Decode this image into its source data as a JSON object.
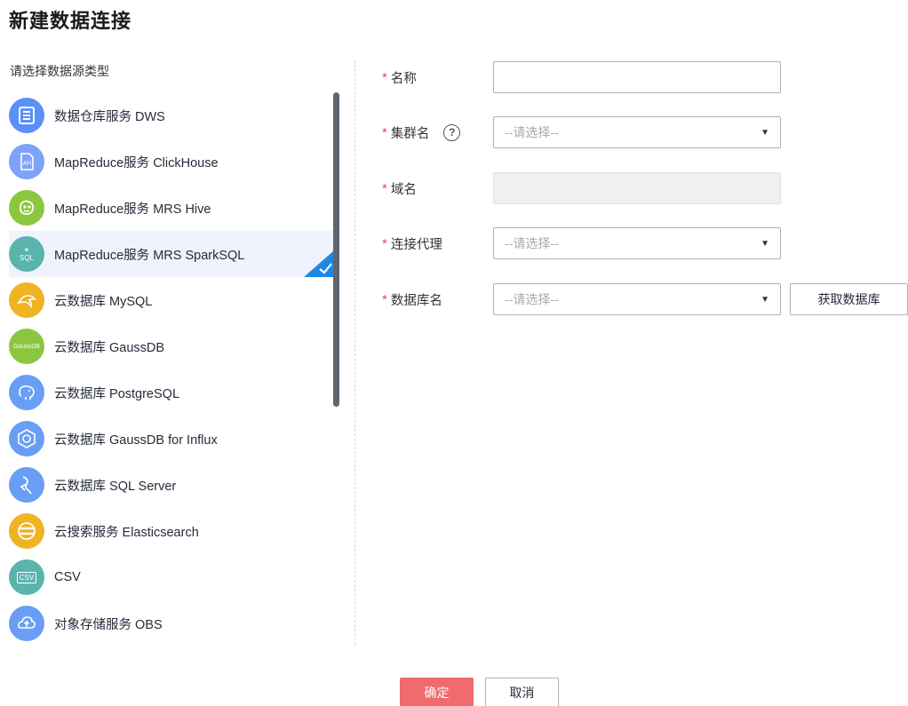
{
  "dialog": {
    "title": "新建数据连接"
  },
  "left": {
    "label": "请选择数据源类型",
    "sources": [
      {
        "label": "数据仓库服务 DWS",
        "icon": "database-warehouse-icon",
        "color": "#5b8ff9",
        "selected": false
      },
      {
        "label": "MapReduce服务 ClickHouse",
        "icon": "api-document-icon",
        "color": "#7ea2f7",
        "selected": false
      },
      {
        "label": "MapReduce服务 MRS Hive",
        "icon": "hive-bee-icon",
        "color": "#8cc63f",
        "selected": false
      },
      {
        "label": "MapReduce服务 MRS SparkSQL",
        "icon": "spark-sql-icon",
        "color": "#5ab4ac",
        "selected": true,
        "icon_text": "SQL"
      },
      {
        "label": "云数据库 MySQL",
        "icon": "mysql-dolphin-icon",
        "color": "#f0b323",
        "selected": false
      },
      {
        "label": "云数据库 GaussDB",
        "icon": "gaussdb-icon",
        "color": "#8cc63f",
        "selected": false,
        "icon_text": "GaussDB"
      },
      {
        "label": "云数据库 PostgreSQL",
        "icon": "postgresql-elephant-icon",
        "color": "#6a9ef5",
        "selected": false
      },
      {
        "label": "云数据库 GaussDB for Influx",
        "icon": "influx-hexagon-icon",
        "color": "#6a9ef5",
        "selected": false
      },
      {
        "label": "云数据库 SQL Server",
        "icon": "sql-server-icon",
        "color": "#6a9ef5",
        "selected": false
      },
      {
        "label": "云搜索服务 Elasticsearch",
        "icon": "elasticsearch-icon",
        "color": "#f0b323",
        "selected": false
      },
      {
        "label": "CSV",
        "icon": "csv-file-icon",
        "color": "#5ab4ac",
        "selected": false,
        "icon_text": "CSV"
      },
      {
        "label": "对象存储服务 OBS",
        "icon": "obs-cloud-icon",
        "color": "#6a9ef5",
        "selected": false
      }
    ],
    "selected_check_color": "#1e88e5"
  },
  "form": {
    "name": {
      "label": "名称",
      "value": "",
      "placeholder": ""
    },
    "cluster": {
      "label": "集群名",
      "placeholder": "--请选择--",
      "help": "?"
    },
    "domain": {
      "label": "域名",
      "value": ""
    },
    "proxy": {
      "label": "连接代理",
      "placeholder": "--请选择--"
    },
    "database": {
      "label": "数据库名",
      "placeholder": "--请选择--",
      "fetch_button": "获取数据库"
    },
    "required_mark": "*"
  },
  "footer": {
    "ok": "确定",
    "cancel": "取消"
  },
  "colors": {
    "accent_red": "#f06b6b",
    "required_red": "#e84b4b",
    "selected_bg": "#eef3fd"
  }
}
